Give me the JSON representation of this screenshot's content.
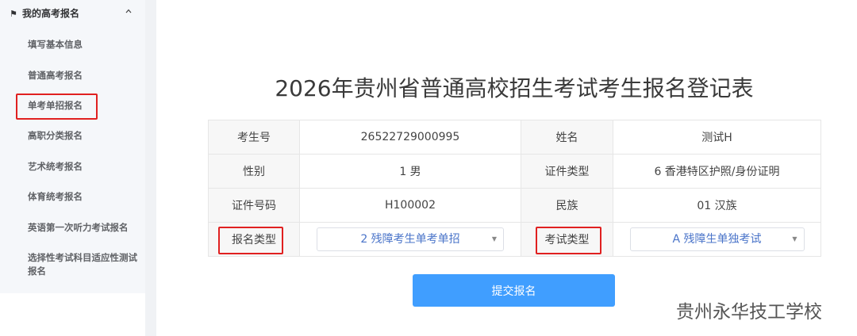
{
  "sidebar": {
    "header": "我的高考报名",
    "items": [
      {
        "label": "填写基本信息"
      },
      {
        "label": "普通高考报名"
      },
      {
        "label": "单考单招报名"
      },
      {
        "label": "高职分类报名"
      },
      {
        "label": "艺术统考报名"
      },
      {
        "label": "体育统考报名"
      },
      {
        "label": "英语第一次听力考试报名"
      },
      {
        "label": "选择性考试科目适应性测试报名"
      }
    ]
  },
  "main": {
    "title": "2026年贵州省普通高校招生考试考生报名登记表",
    "rows": [
      {
        "label1": "考生号",
        "value1": "26522729000995",
        "label2": "姓名",
        "value2": "测试H"
      },
      {
        "label1": "性别",
        "value1": "1 男",
        "label2": "证件类型",
        "value2": "6 香港特区护照/身份证明"
      },
      {
        "label1": "证件号码",
        "value1": "H100002",
        "label2": "民族",
        "value2": "01 汉族"
      }
    ],
    "select_row": {
      "label1": "报名类型",
      "select1": "2 残障考生单考单招",
      "label2": "考试类型",
      "select2": "A 残障生单独考试"
    },
    "submit_label": "提交报名"
  },
  "watermark": "贵州永华技工学校",
  "colors": {
    "highlight": "#e02020",
    "primary": "#409eff",
    "select_text": "#4a74c9"
  }
}
